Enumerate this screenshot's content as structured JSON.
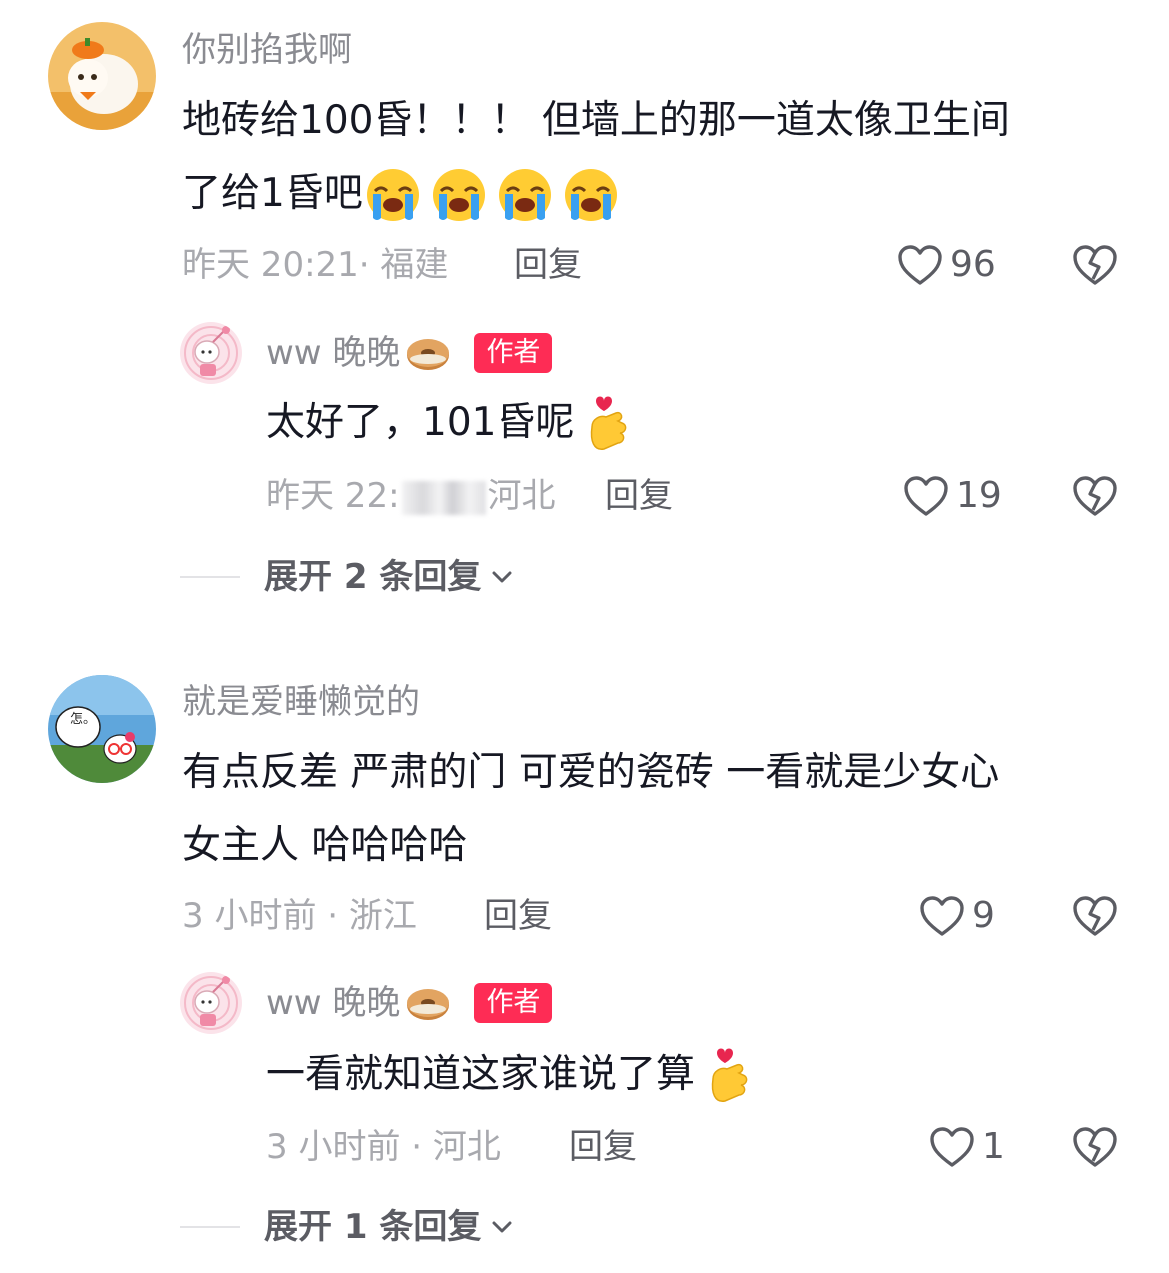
{
  "comments": [
    {
      "username": "你别掐我啊",
      "text_line1": "地砖给100昏！！！ 但墙上的那一道太像卫生间",
      "text_line2": "了给1昏吧",
      "emoji_icons": [
        "loudly-crying-face-icon",
        "loudly-crying-face-icon",
        "loudly-crying-face-icon",
        "loudly-crying-face-icon"
      ],
      "meta": "昨天 20:21· 福建",
      "reply_label": "回复",
      "likes": "96",
      "reply": {
        "username": "ww 晚晚",
        "badge": "作者",
        "text": "太好了，101昏呢",
        "meta_prefix": "昨天 22:",
        "meta_suffix": "河北",
        "reply_label": "回复",
        "likes": "19"
      },
      "expand_label": "展开 2 条回复"
    },
    {
      "username": "就是爱睡懒觉的",
      "text_line1": "有点反差 严肃的门 可爱的瓷砖 一看就是少女心",
      "text_line2": "女主人 哈哈哈哈",
      "meta": "3 小时前 · 浙江",
      "reply_label": "回复",
      "likes": "9",
      "avatar_text": "怎。",
      "reply": {
        "username": "ww 晚晚",
        "badge": "作者",
        "text": "一看就知道这家谁说了算",
        "meta": "3 小时前 · 河北",
        "reply_label": "回复",
        "likes": "1"
      },
      "expand_label": "展开 1 条回复"
    }
  ],
  "colors": {
    "author_badge": "#fe2c55",
    "username": "#8a8b91",
    "meta": "#a8a9ae",
    "text": "#161823"
  },
  "icons": {
    "like": "heart-outline-icon",
    "dislike": "broken-heart-icon",
    "expand": "chevron-down-icon",
    "reply_emoji": "finger-heart-icon",
    "username_emoji": "bagel-icon"
  }
}
